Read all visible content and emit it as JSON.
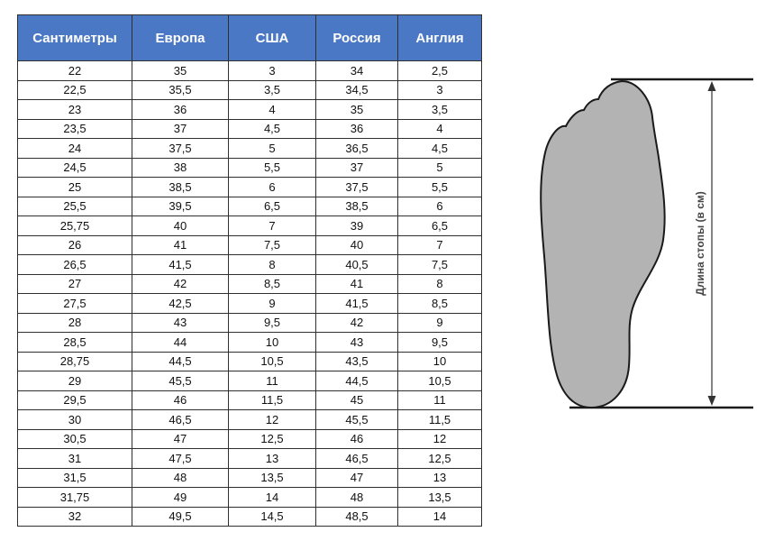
{
  "table": {
    "headers": [
      "Сантиметры",
      "Европа",
      "США",
      "Россия",
      "Англия"
    ],
    "rows": [
      [
        "22",
        "35",
        "3",
        "34",
        "2,5"
      ],
      [
        "22,5",
        "35,5",
        "3,5",
        "34,5",
        "3"
      ],
      [
        "23",
        "36",
        "4",
        "35",
        "3,5"
      ],
      [
        "23,5",
        "37",
        "4,5",
        "36",
        "4"
      ],
      [
        "24",
        "37,5",
        "5",
        "36,5",
        "4,5"
      ],
      [
        "24,5",
        "38",
        "5,5",
        "37",
        "5"
      ],
      [
        "25",
        "38,5",
        "6",
        "37,5",
        "5,5"
      ],
      [
        "25,5",
        "39,5",
        "6,5",
        "38,5",
        "6"
      ],
      [
        "25,75",
        "40",
        "7",
        "39",
        "6,5"
      ],
      [
        "26",
        "41",
        "7,5",
        "40",
        "7"
      ],
      [
        "26,5",
        "41,5",
        "8",
        "40,5",
        "7,5"
      ],
      [
        "27",
        "42",
        "8,5",
        "41",
        "8"
      ],
      [
        "27,5",
        "42,5",
        "9",
        "41,5",
        "8,5"
      ],
      [
        "28",
        "43",
        "9,5",
        "42",
        "9"
      ],
      [
        "28,5",
        "44",
        "10",
        "43",
        "9,5"
      ],
      [
        "28,75",
        "44,5",
        "10,5",
        "43,5",
        "10"
      ],
      [
        "29",
        "45,5",
        "11",
        "44,5",
        "10,5"
      ],
      [
        "29,5",
        "46",
        "11,5",
        "45",
        "11"
      ],
      [
        "30",
        "46,5",
        "12",
        "45,5",
        "11,5"
      ],
      [
        "30,5",
        "47",
        "12,5",
        "46",
        "12"
      ],
      [
        "31",
        "47,5",
        "13",
        "46,5",
        "12,5"
      ],
      [
        "31,5",
        "48",
        "13,5",
        "47",
        "13"
      ],
      [
        "31,75",
        "49",
        "14",
        "48",
        "13,5"
      ],
      [
        "32",
        "49,5",
        "14,5",
        "48,5",
        "14"
      ]
    ]
  },
  "figure": {
    "dimension_label": "Длина стопы (в см)"
  },
  "colors": {
    "header_bg": "#4a78c4",
    "header_text": "#ffffff",
    "foot_fill": "#b3b3b3",
    "foot_stroke": "#1a1a1a"
  }
}
